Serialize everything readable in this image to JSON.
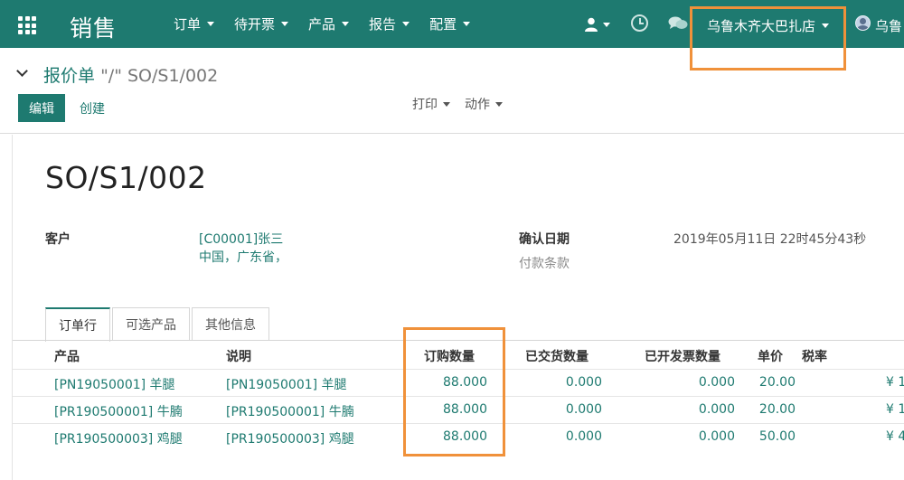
{
  "navbar": {
    "brand": "销售",
    "menu": [
      {
        "label": "订单"
      },
      {
        "label": "待开票"
      },
      {
        "label": "产品"
      },
      {
        "label": "报告"
      },
      {
        "label": "配置"
      }
    ],
    "company": "乌鲁木齐大巴扎店",
    "user": "乌鲁",
    "colors": {
      "bar": "#1e7a70",
      "highlight": "#f0913a"
    }
  },
  "control": {
    "breadcrumb_parent": "报价单",
    "breadcrumb_current": "\"/\" SO/S1/002",
    "edit_label": "编辑",
    "create_label": "创建",
    "print_label": "打印",
    "action_label": "动作"
  },
  "form": {
    "title": "SO/S1/002",
    "customer_label": "客户",
    "customer_name": "[C00001]张三",
    "customer_address": "中国，广东省，",
    "confirm_label": "确认日期",
    "confirm_value": "2019年05月11日 22时45分43秒",
    "payment_label": "付款条款"
  },
  "tabs": [
    {
      "label": "订单行",
      "active": true
    },
    {
      "label": "可选产品",
      "active": false
    },
    {
      "label": "其他信息",
      "active": false
    }
  ],
  "table": {
    "headers": {
      "product": "产品",
      "description": "说明",
      "qty": "订购数量",
      "delivered": "已交货数量",
      "invoiced": "已开发票数量",
      "price": "单价",
      "tax": "税率"
    },
    "rows": [
      {
        "product": "[PN19050001] 羊腿",
        "description": "[PN19050001] 羊腿",
        "qty": "88.000",
        "delivered": "0.000",
        "invoiced": "0.000",
        "price": "20.00",
        "subtotal": "¥ 1"
      },
      {
        "product": "[PR190500001] 牛腩",
        "description": "[PR190500001] 牛腩",
        "qty": "88.000",
        "delivered": "0.000",
        "invoiced": "0.000",
        "price": "20.00",
        "subtotal": "¥ 1"
      },
      {
        "product": "[PR190500003] 鸡腿",
        "description": "[PR190500003] 鸡腿",
        "qty": "88.000",
        "delivered": "0.000",
        "invoiced": "0.000",
        "price": "50.00",
        "subtotal": "¥ 4"
      }
    ]
  }
}
